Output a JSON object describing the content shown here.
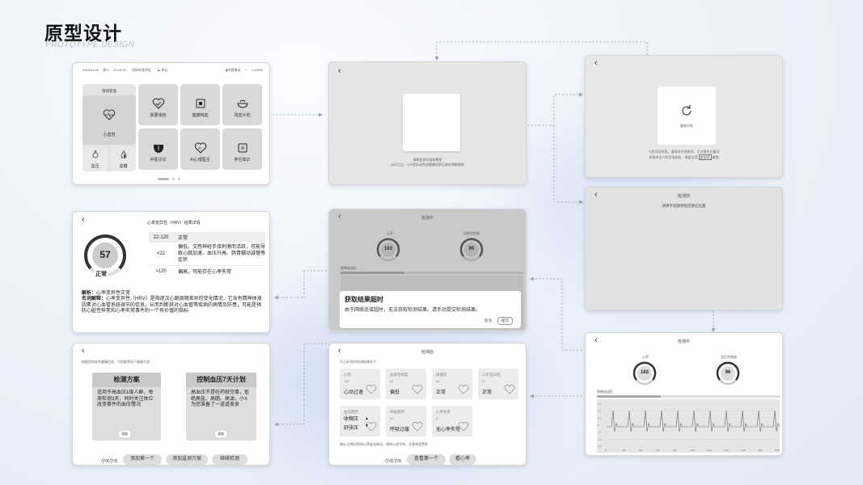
{
  "header": {
    "title": "原型设计",
    "subtitle": "PROTOTYPE DESIGN"
  },
  "home": {
    "status": {
      "date": "2019/01/22",
      "weekday": "周二",
      "time": "10:04:32",
      "location": "深圳市龙华区",
      "weather": "多云",
      "carrier": "中国移动",
      "battery": "100%"
    },
    "group_label": "慢病管理",
    "big_tile": "心血管",
    "small_tiles": [
      "血压",
      "血糖"
    ],
    "tiles": [
      "我要体检",
      "健康档案",
      "改善计划",
      "中医诊诊",
      "AI心理医生",
      "养生知识"
    ]
  },
  "face": {
    "line1": "请将面部对准取景框",
    "line2": "认识之后，小R会自动完成健康档案记录检测数据哦"
  },
  "retry": {
    "btn": "重新识别",
    "line1": "人脸识别失败，请保持光线良好，正对镜头后重试",
    "line2": "如果多次人脸识别失败，请尝试用",
    "link": "安全码",
    "line3": "解锁"
  },
  "detect_pre": {
    "title": "检测前",
    "text": "请将手指放到指定感应位置"
  },
  "detecting": {
    "title": "检测中",
    "heart_label": "心率",
    "heart_value": "163",
    "oxy_label": "血压饱和度",
    "oxy_value": "96",
    "wave_label": "脉搏波波形",
    "y_ticks": [
      "1.5",
      "1.0",
      "0.5",
      "0",
      "-0.5",
      "-1.0",
      "-1.5"
    ],
    "x_ticks": [
      "0",
      "200",
      "400",
      "600",
      "800",
      "1000",
      "1200",
      "1400",
      "1600",
      "1800",
      "2000"
    ]
  },
  "timeout": {
    "title": "检测中",
    "heart_label": "心率",
    "oxy_label": "血氧饱和度",
    "heart_value": "163",
    "oxy_value": "96",
    "wave_label": "脉搏波波形",
    "dialog_title": "获取结果超时",
    "dialog_text": "由于网络连接超时，无法获取检测结果。请手动提交检测结果。",
    "cancel": "取消",
    "submit": "提交"
  },
  "hrv": {
    "title": "心率变异性（HRV）结果详情",
    "score": "57",
    "status": "正常",
    "rows": [
      {
        "range": "22-120",
        "desc": "正常"
      },
      {
        "range": "<22",
        "desc": "偏低。交感神经手接刺激而活跃，可能导致心跳加速、血压升高、肠胃蠕动减慢等症状"
      },
      {
        "range": ">120",
        "desc": "偏高，可能存在心率失常"
      }
    ],
    "analysis_label": "解析：",
    "analysis": "心率变异性正常",
    "term_label": "名词解释：",
    "term": "心率变异性（HRV）是指逐次心跳周期差异的变化情况，它含有精神体液因素对心血管系统调节的信息，从而判断其对心血管等疾病的病情及防患，可能是预防心脏性猝死和心率失常事件的一个有价值的指标"
  },
  "plans": {
    "intro": "根据您的综合健康信息，为您推荐如下健康方案：",
    "plan1": {
      "title": "检测方案",
      "text": "适用于高血压1级人群，每周检测3天，同时关注体位改变事件的血压情况",
      "btn": "添加"
    },
    "plan2": {
      "title": "控制血压7天计划",
      "text": "高血压不是吃药就完事，拒绝高盐、高脂、高油，小π为您准备了一道道美食",
      "btn": "添加"
    },
    "voice": "小π小π",
    "chips": [
      "添加第一个",
      "添加监测方案",
      "继续检测"
    ]
  },
  "results": {
    "title": "检测后",
    "intro": "早上好!您的检测结果如下:",
    "metrics": [
      {
        "name": "心率",
        "value": "102",
        "status": "心动过速"
      },
      {
        "name": "血氧饱和度",
        "value": "94",
        "status": "偏低"
      },
      {
        "name": "微循环",
        "value": "80",
        "status": "正常"
      },
      {
        "name": "心率变异性",
        "value": "57",
        "status": "正常"
      },
      {
        "name": "血压趋势",
        "value": "",
        "status": "收缩压"
      },
      {
        "name": "呼吸频率",
        "value": "10",
        "status": "呼吸过缓"
      },
      {
        "name": "心率失常",
        "value": "0",
        "status": "无心率失常"
      }
    ],
    "bp_second": "舒张压",
    "advice": "建议:近期对您的心率变化情况，保持心态平和，注意休息贯养",
    "voice": "小π小π",
    "chips": [
      "查看第一个",
      "看心率"
    ]
  }
}
